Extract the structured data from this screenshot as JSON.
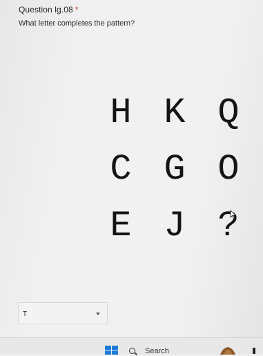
{
  "question": {
    "title": "Question lg.08",
    "required_mark": "*",
    "prompt": "What letter completes the pattern?"
  },
  "puzzle": {
    "rows": [
      [
        "H",
        "K",
        "Q"
      ],
      [
        "C",
        "G",
        "O"
      ],
      [
        "E",
        "J",
        "?"
      ]
    ]
  },
  "answer": {
    "selected_value": "T"
  },
  "taskbar": {
    "search_label": "Search"
  },
  "colors": {
    "required": "#d93025",
    "windows_logo": "#1a7ad8"
  }
}
